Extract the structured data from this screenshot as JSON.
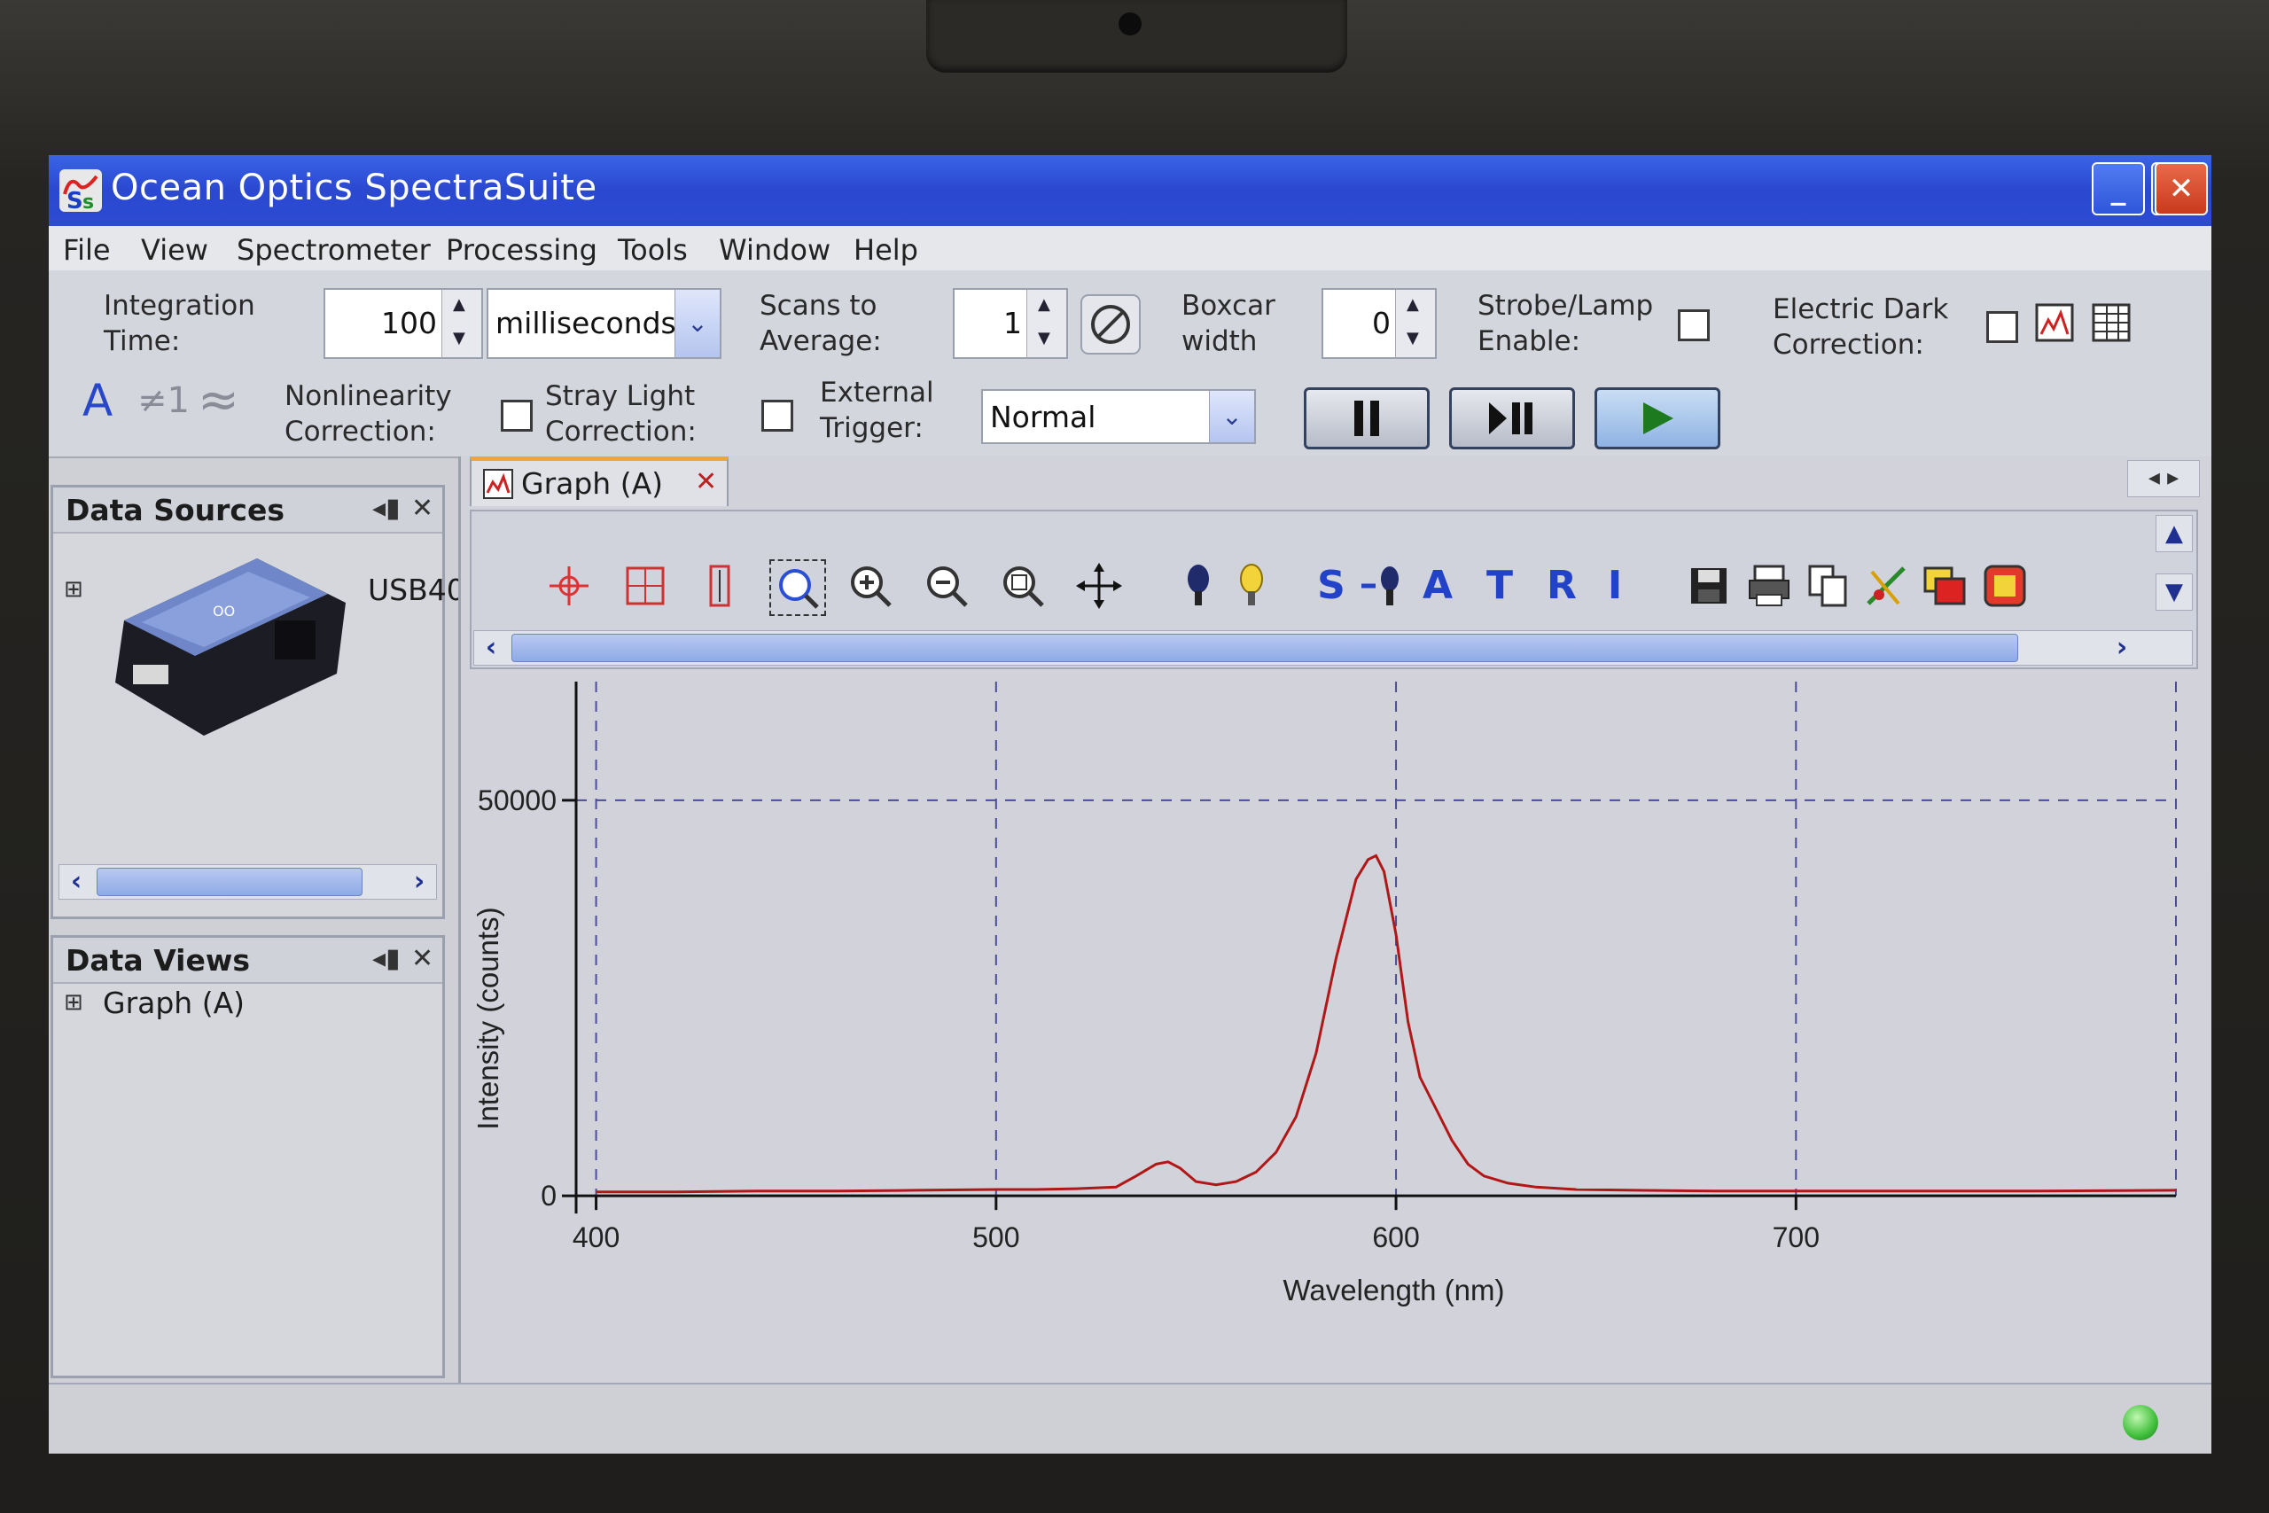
{
  "window": {
    "title": "Ocean Optics SpectraSuite",
    "minimize": "_",
    "restore": "❐",
    "close": "✕"
  },
  "menu": [
    "File",
    "View",
    "Spectrometer",
    "Processing",
    "Tools",
    "Window",
    "Help"
  ],
  "acquisition": {
    "integration_label_1": "Integration",
    "integration_label_2": "Time:",
    "integration_value": "100",
    "integration_unit": "milliseconds",
    "scans_label_1": "Scans to",
    "scans_label_2": "Average:",
    "scans_value": "1",
    "boxcar_label_1": "Boxcar",
    "boxcar_label_2": "width",
    "boxcar_value": "0",
    "strobe_label_1": "Strobe/Lamp",
    "strobe_label_2": "Enable:",
    "dark_label_1": "Electric Dark",
    "dark_label_2": "Correction:",
    "nonlinearity_label_1": "Nonlinearity",
    "nonlinearity_label_2": "Correction:",
    "stray_label_1": "Stray Light",
    "stray_label_2": "Correction:",
    "trigger_label_1": "External",
    "trigger_label_2": "Trigger:",
    "trigger_mode": "Normal",
    "sym_a": "A",
    "sym_ne1": "≠1",
    "sym_approx": "≈"
  },
  "data_sources": {
    "title": "Data Sources",
    "device": "USB40",
    "expander": "⊞"
  },
  "data_views": {
    "title": "Data Views",
    "item": "Graph (A)",
    "expander": "⊞"
  },
  "graph_tab": {
    "label": "Graph (A)",
    "close": "✕"
  },
  "graph_tools": {
    "s": "S",
    "a": "A",
    "t": "T",
    "r": "R",
    "i": "I"
  },
  "chart_data": {
    "type": "line",
    "xlabel": "Wavelength (nm)",
    "ylabel": "Intensity (counts)",
    "xlim": [
      395,
      795
    ],
    "ylim": [
      -2000,
      65000
    ],
    "xticks": [
      400,
      500,
      600,
      700
    ],
    "yticks": [
      0,
      50000
    ],
    "ytick_labels": [
      "0",
      "50000"
    ],
    "grid": true,
    "series": [
      {
        "color": "#b01818",
        "x": [
          400,
          420,
          440,
          460,
          480,
          500,
          510,
          520,
          530,
          535,
          540,
          543,
          546,
          550,
          555,
          560,
          565,
          570,
          575,
          580,
          585,
          590,
          593,
          595,
          597,
          600,
          603,
          606,
          610,
          614,
          618,
          622,
          628,
          635,
          645,
          660,
          680,
          700,
          730,
          760,
          795
        ],
        "y": [
          500,
          500,
          600,
          600,
          700,
          800,
          800,
          900,
          1100,
          2500,
          4000,
          4300,
          3500,
          1800,
          1400,
          1800,
          3000,
          5500,
          10000,
          18000,
          30000,
          40000,
          42500,
          43000,
          41000,
          33000,
          22000,
          15000,
          11000,
          7000,
          4000,
          2500,
          1600,
          1100,
          800,
          700,
          600,
          600,
          600,
          600,
          700
        ]
      }
    ]
  },
  "colors": {
    "titlebar": "#2a48d0",
    "accent": "#2c4bd3",
    "trace": "#b01818"
  }
}
